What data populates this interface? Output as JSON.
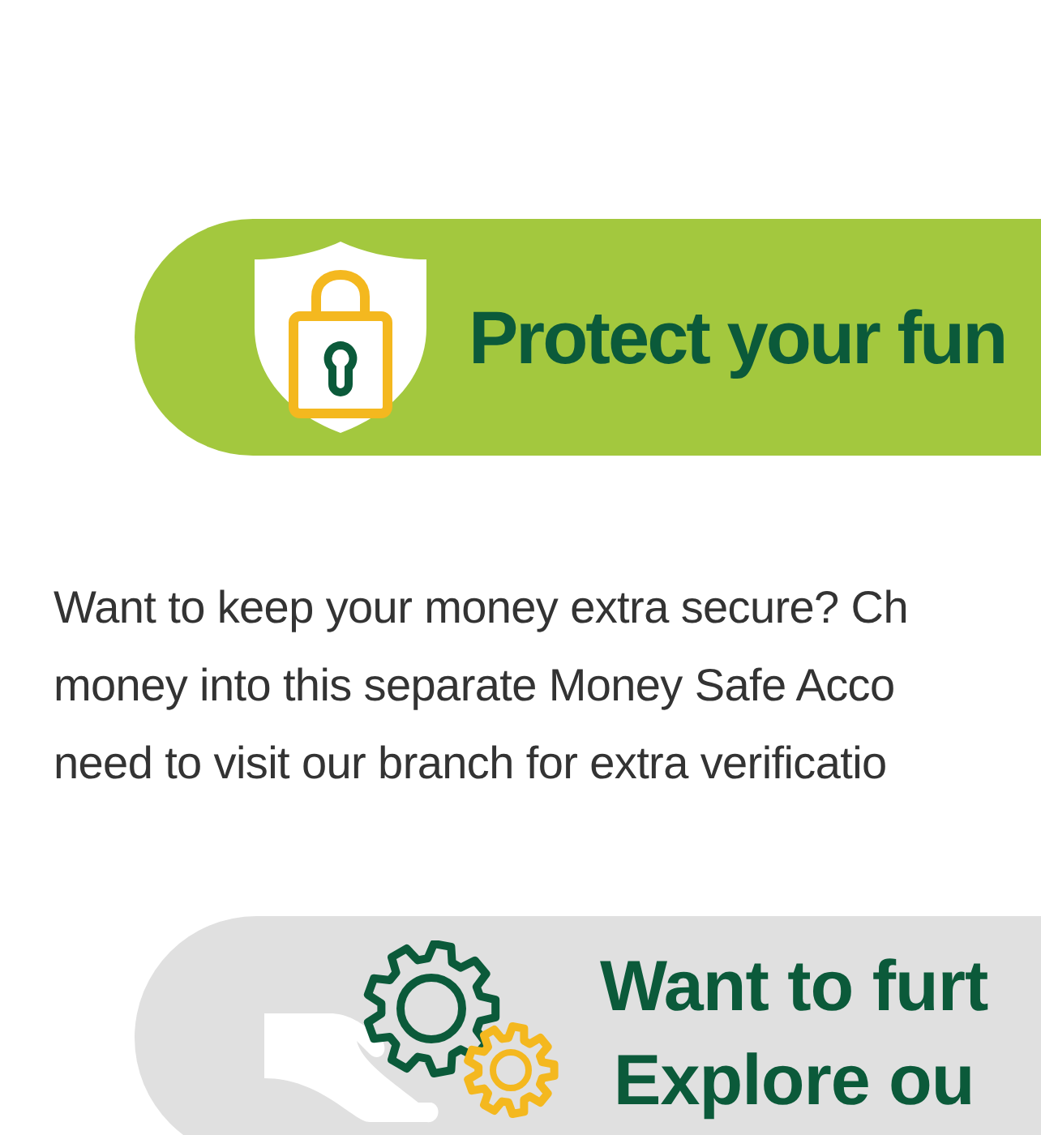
{
  "protect_banner": {
    "title": "Protect your fun"
  },
  "intro": {
    "lines": [
      "Want to keep your money extra secure? Ch",
      "money into this separate Money Safe Acco",
      "need to visit our branch for extra verificatio"
    ]
  },
  "explore_banner": {
    "lines": [
      "Want to furt",
      "Explore ou"
    ]
  }
}
